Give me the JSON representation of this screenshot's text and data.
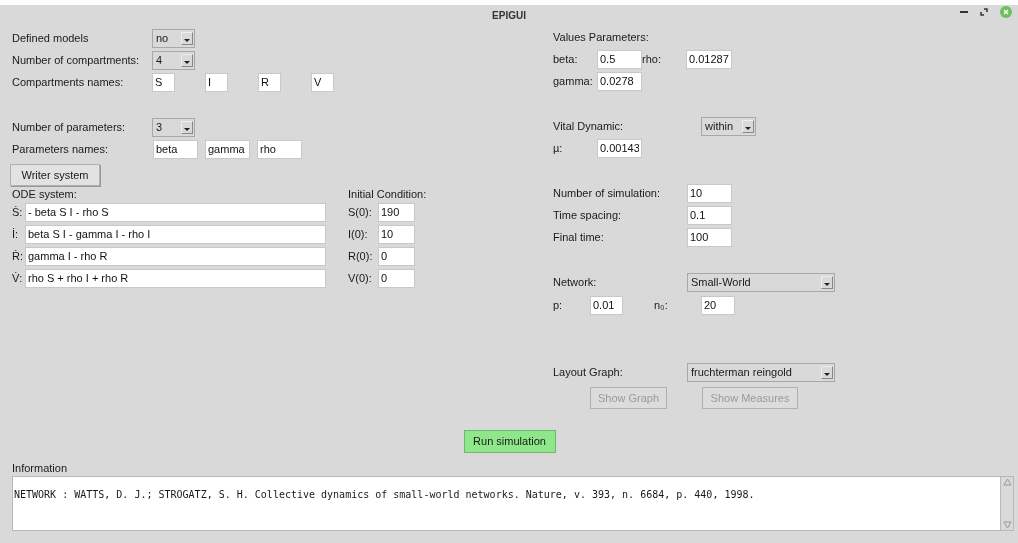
{
  "window": {
    "title": "EPIGUI"
  },
  "model_setup": {
    "defined_models": {
      "label": "Defined models",
      "value": "no"
    },
    "number_of_compartments": {
      "label": "Number of compartments:",
      "value": "4"
    },
    "compartments_names": {
      "label": "Compartments names:",
      "values": [
        "S",
        "I",
        "R",
        "V"
      ]
    },
    "number_of_parameters": {
      "label": "Number of parameters:",
      "value": "3"
    },
    "parameters_names": {
      "label": "Parameters names:",
      "values": [
        "beta",
        "gamma",
        "rho"
      ]
    },
    "writer_button": "Writer system"
  },
  "ode_system": {
    "label": "ODE system:",
    "equations": [
      {
        "symbol": "Ṡ:",
        "value": "- beta S I - rho S"
      },
      {
        "symbol": "İ:",
        "value": "beta S I - gamma I - rho I"
      },
      {
        "symbol": "Ṙ:",
        "value": "gamma I - rho R"
      },
      {
        "symbol": "V̇:",
        "value": "rho S + rho I + rho R"
      }
    ]
  },
  "initial_condition": {
    "label": "Initial Condition:",
    "items": [
      {
        "label": "S(0):",
        "value": "190"
      },
      {
        "label": "I(0):",
        "value": "10"
      },
      {
        "label": "R(0):",
        "value": "0"
      },
      {
        "label": "V(0):",
        "value": "0"
      }
    ]
  },
  "values_parameters": {
    "label": "Values Parameters:",
    "items": [
      {
        "label": "beta:",
        "value": "0.5"
      },
      {
        "label": "rho:",
        "value": "0.01287"
      },
      {
        "label": "gamma:",
        "value": "0.0278"
      }
    ]
  },
  "vital_dynamic": {
    "label": "Vital Dynamic:",
    "value": "within",
    "mu": {
      "label": "µ:",
      "value": "0.00143"
    }
  },
  "simulation": [
    {
      "label": "Number of simulation:",
      "value": "10"
    },
    {
      "label": "Time spacing:",
      "value": "0.1"
    },
    {
      "label": "Final time:",
      "value": "100"
    }
  ],
  "network": {
    "label": "Network:",
    "value": "Small-World",
    "params": [
      {
        "label": "p:",
        "value": "0.01"
      },
      {
        "label": "n₀:",
        "value": "20"
      }
    ]
  },
  "layout_graph": {
    "label": "Layout Graph:",
    "value": "fruchterman reingold"
  },
  "graph_buttons": [
    {
      "label": "Show Graph",
      "disabled": true
    },
    {
      "label": "Show Measures",
      "disabled": true
    }
  ],
  "run_button": "Run simulation",
  "information": {
    "label": "Information",
    "text": "NETWORK : WATTS, D. J.; STROGATZ, S. H. Collective dynamics of small-world networks. Nature, v. 393, n. 6684, p. 440, 1998."
  }
}
